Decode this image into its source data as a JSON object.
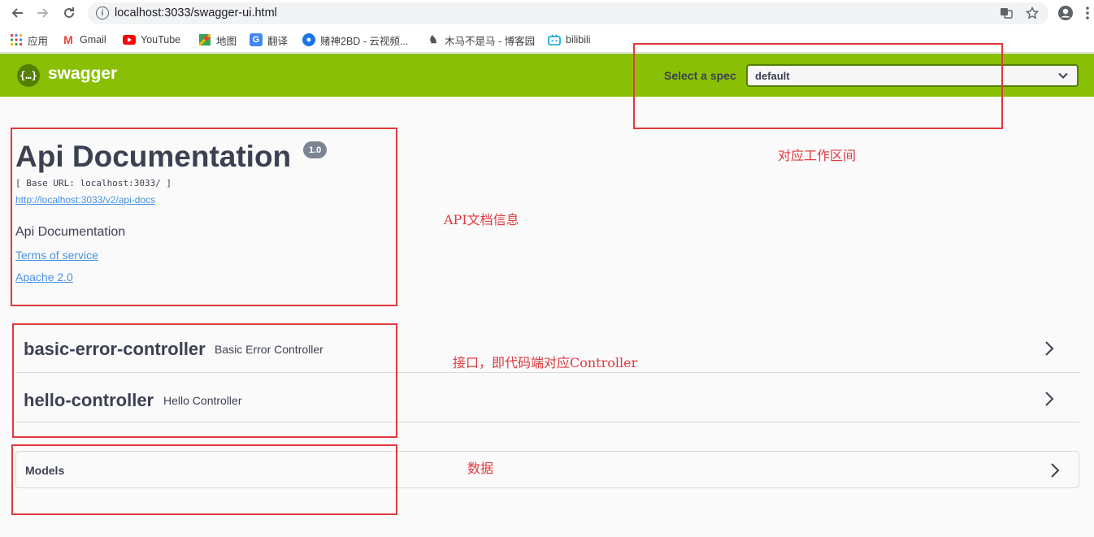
{
  "browser": {
    "url": "localhost:3033/swagger-ui.html",
    "bookmarks": [
      {
        "label": "应用",
        "icon": "apps-grid-icon"
      },
      {
        "label": "Gmail",
        "icon": "gmail-icon",
        "color": "#ea4335"
      },
      {
        "label": "YouTube",
        "icon": "youtube-icon",
        "color": "#ff0000"
      },
      {
        "label": "地图",
        "icon": "maps-icon",
        "color": "#34a853"
      },
      {
        "label": "翻译",
        "icon": "translate-icon",
        "color": "#4285f4"
      },
      {
        "label": "赌神2BD - 云视频...",
        "icon": "video-site-icon",
        "color": "#1a73e8"
      },
      {
        "label": "木马不是马 - 博客园",
        "icon": "blog-icon",
        "color": "#555555"
      },
      {
        "label": "bilibili",
        "icon": "bilibili-icon",
        "color": "#00a1d6"
      }
    ]
  },
  "topbar": {
    "logo_text": "swagger",
    "spec_label": "Select a spec",
    "spec_value": "default"
  },
  "info": {
    "title": "Api Documentation",
    "version": "1.0",
    "base_url": "[ Base URL: localhost:3033/ ]",
    "api_docs_link": "http://localhost:3033/v2/api-docs",
    "description": "Api Documentation",
    "terms_link": "Terms of service",
    "license_link": "Apache 2.0"
  },
  "tags": [
    {
      "name": "basic-error-controller",
      "description": "Basic Error Controller"
    },
    {
      "name": "hello-controller",
      "description": "Hello Controller"
    }
  ],
  "models": {
    "title": "Models"
  },
  "annotations": {
    "spec": "对应工作区间",
    "info": "API文档信息",
    "tags": "接口，即代码端对应Controller",
    "models": "数据"
  },
  "colors": {
    "topbar": "#89bf04",
    "text": "#3b4151",
    "link": "#4990e2",
    "annotation": "#e0393e"
  }
}
